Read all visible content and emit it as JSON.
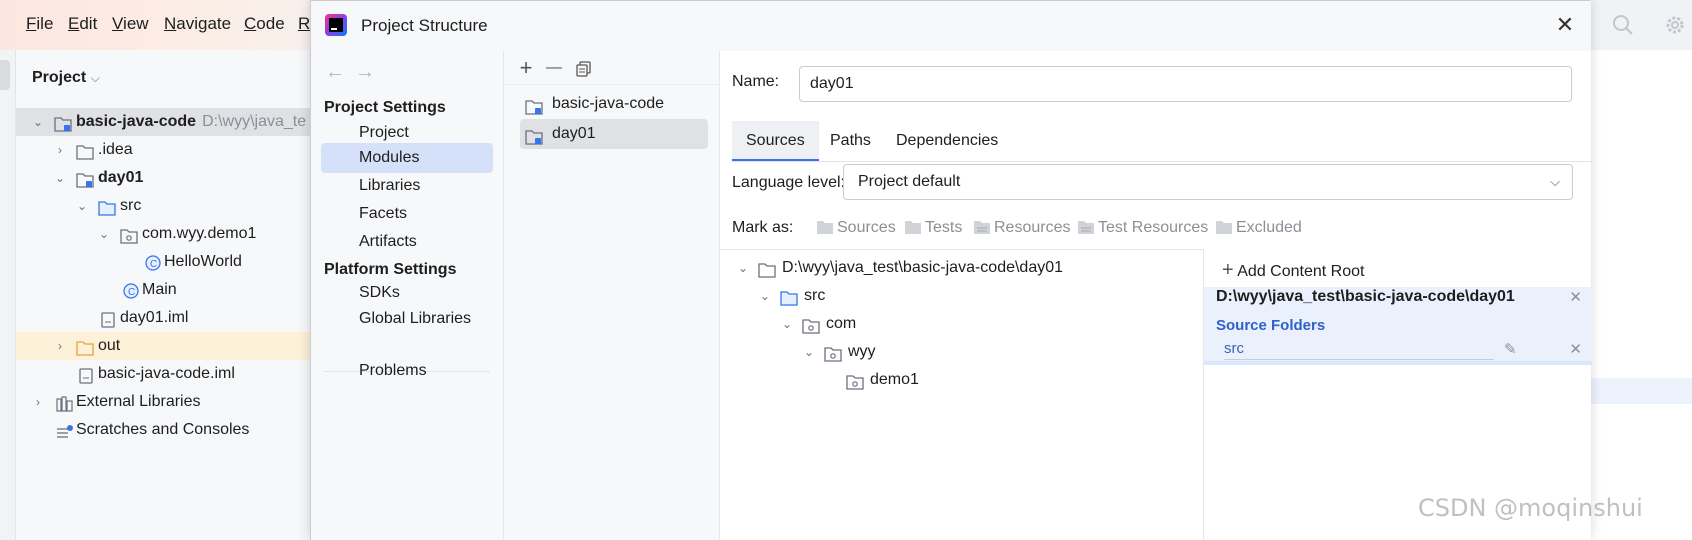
{
  "ide": {
    "menu": [
      {
        "label": "File",
        "mnemonic": "F",
        "rest": "ile"
      },
      {
        "label": "Edit",
        "mnemonic": "E",
        "rest": "dit"
      },
      {
        "label": "View",
        "mnemonic": "V",
        "rest": "iew"
      },
      {
        "label": "Navigate",
        "mnemonic": "N",
        "rest": "avigate"
      },
      {
        "label": "Code",
        "mnemonic": "C",
        "rest": "ode"
      },
      {
        "label": "R",
        "mnemonic": "R",
        "rest": ""
      }
    ],
    "project_panel": {
      "title": "Project",
      "tree": [
        {
          "label": "basic-java-code",
          "path": "D:\\wyy\\java_te",
          "icon": "module-folder-icon"
        },
        {
          "label": ".idea",
          "icon": "folder-icon"
        },
        {
          "label": "day01",
          "icon": "module-folder-icon"
        },
        {
          "label": "src",
          "icon": "source-folder-icon"
        },
        {
          "label": "com.wyy.demo1",
          "icon": "package-icon"
        },
        {
          "label": "HelloWorld",
          "icon": "java-class-icon"
        },
        {
          "label": "Main",
          "icon": "java-class-icon"
        },
        {
          "label": "day01.iml",
          "icon": "iml-file-icon"
        },
        {
          "label": "out",
          "icon": "excluded-folder-icon"
        },
        {
          "label": "basic-java-code.iml",
          "icon": "iml-file-icon"
        },
        {
          "label": "External Libraries",
          "icon": "library-icon"
        },
        {
          "label": "Scratches and Consoles",
          "icon": "scratches-icon"
        }
      ]
    }
  },
  "dialog": {
    "title": "Project Structure",
    "close_label": "✕",
    "nav": {
      "back": "←",
      "forward": "→",
      "project_settings_header": "Project Settings",
      "project_settings": [
        "Project",
        "Modules",
        "Libraries",
        "Facets",
        "Artifacts"
      ],
      "platform_settings_header": "Platform Settings",
      "platform_settings": [
        "SDKs",
        "Global Libraries"
      ],
      "problems": "Problems",
      "active": "Modules"
    },
    "modules": {
      "toolbar": {
        "add": "+",
        "remove": "—",
        "copy": "copy-icon"
      },
      "items": [
        "basic-java-code",
        "day01"
      ],
      "selected": "day01"
    },
    "content": {
      "name_label": "Name:",
      "name_value": "day01",
      "tabs": [
        "Sources",
        "Paths",
        "Dependencies"
      ],
      "active_tab": "Sources",
      "language_level_label": "Language level:",
      "language_level_value": "Project default",
      "mark_as_label": "Mark as:",
      "mark_as": [
        "Sources",
        "Tests",
        "Resources",
        "Test Resources",
        "Excluded"
      ],
      "tree": [
        {
          "label": "D:\\wyy\\java_test\\basic-java-code\\day01",
          "icon": "folder-icon"
        },
        {
          "label": "src",
          "icon": "source-folder-icon"
        },
        {
          "label": "com",
          "icon": "package-icon"
        },
        {
          "label": "wyy",
          "icon": "package-icon"
        },
        {
          "label": "demo1",
          "icon": "package-icon"
        }
      ],
      "roots": {
        "add_content_root": "Add Content Root",
        "root_path": "D:\\wyy\\java_test\\basic-java-code\\day01",
        "source_folders_title": "Source Folders",
        "source_folders": [
          "src"
        ]
      }
    }
  },
  "watermark": "CSDN @moqinshui",
  "colors": {
    "accent": "#3574f0",
    "selection": "#d5e1f9",
    "source_folder": "#3574f0",
    "excluded_folder": "#e8a33d",
    "source_folders_title": "#2e62c9"
  }
}
